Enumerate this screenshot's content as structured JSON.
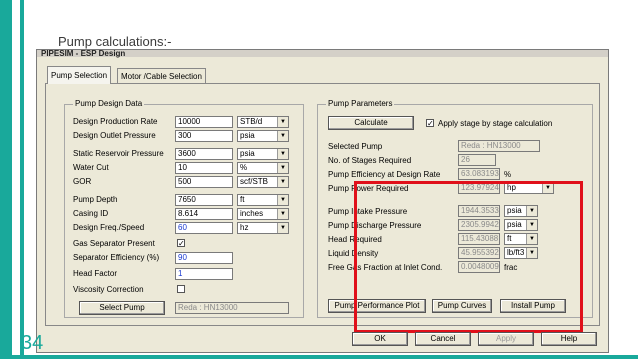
{
  "slide": {
    "title": "Pump calculations:-",
    "number": "34"
  },
  "window": {
    "title": "PIPESIM - ESP Design"
  },
  "tabs": [
    {
      "label": "Pump Selection"
    },
    {
      "label": "Motor /Cable Selection"
    }
  ],
  "design": {
    "group_title": "Pump Design Data",
    "production_rate": {
      "label": "Design Production Rate",
      "value": "10000",
      "unit": "STB/d"
    },
    "outlet_pressure": {
      "label": "Design Outlet Pressure",
      "value": "300",
      "unit": "psia"
    },
    "reservoir_pressure": {
      "label": "Static Reservoir Pressure",
      "value": "3600",
      "unit": "psia"
    },
    "water_cut": {
      "label": "Water Cut",
      "value": "10",
      "unit": "%"
    },
    "gor": {
      "label": "GOR",
      "value": "500",
      "unit": "scf/STB"
    },
    "pump_depth": {
      "label": "Pump Depth",
      "value": "7650",
      "unit": "ft"
    },
    "casing_id": {
      "label": "Casing ID",
      "value": "8.614",
      "unit": "inches"
    },
    "freq": {
      "label": "Design Freq./Speed",
      "value": "60",
      "unit": "hz"
    },
    "gas_separator": {
      "label": "Gas Separator Present",
      "checked": "✓"
    },
    "separator_eff": {
      "label": "Separator Efficiency (%)",
      "value": "90"
    },
    "head_factor": {
      "label": "Head Factor",
      "value": "1"
    },
    "viscosity": {
      "label": "Viscosity Correction"
    },
    "select_pump": {
      "label": "Select Pump",
      "value": "Reda : HN13000"
    }
  },
  "params": {
    "group_title": "Pump Parameters",
    "calculate_label": "Calculate",
    "apply_stage_label": "Apply stage by stage calculation",
    "apply_stage_checked": "✓",
    "selected_pump": {
      "label": "Selected Pump",
      "value": "Reda : HN13000"
    },
    "stages": {
      "label": "No. of Stages Required",
      "value": "26"
    },
    "efficiency": {
      "label": "Pump Efficiency at Design Rate",
      "value": "63.083193",
      "unit": "%"
    },
    "power": {
      "label": "Pump Power Required",
      "value": "123.97924",
      "unit": "hp"
    },
    "intake": {
      "label": "Pump Intake Pressure",
      "value": "1944.3533",
      "unit": "psia"
    },
    "discharge": {
      "label": "Pump Discharge Pressure",
      "value": "2305.9942",
      "unit": "psia"
    },
    "head": {
      "label": "Head Required",
      "value": "115.43088",
      "unit": "ft"
    },
    "density": {
      "label": "Liquid Density",
      "value": "45.955392",
      "unit": "lb/ft3"
    },
    "free_gas": {
      "label": "Free Gas Fraction at Inlet Cond.",
      "value": "0.00480093",
      "unit": "frac"
    },
    "perf_plot_label": "Pump Performance Plot",
    "curves_label": "Pump Curves",
    "install_label": "Install Pump"
  },
  "footer": {
    "ok": "OK",
    "cancel": "Cancel",
    "apply": "Apply",
    "help": "Help"
  }
}
